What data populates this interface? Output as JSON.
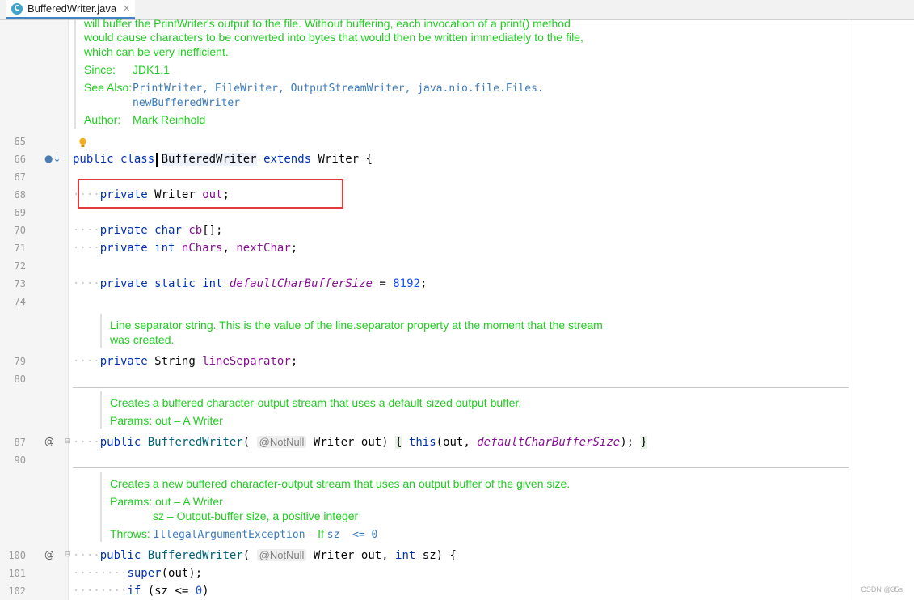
{
  "tab": {
    "icon": "C",
    "title": "BufferedWriter.java",
    "close": "✕"
  },
  "doc_top": {
    "line1": "will buffer the PrintWriter's output to the file. Without buffering, each invocation of a print() method",
    "line2": "would cause characters to be converted into bytes that would then be written immediately to the file,",
    "line3": "which can be very inefficient.",
    "since_label": "Since:",
    "since_value": "JDK1.1",
    "see_label": "See Also:",
    "see_value1": "PrintWriter, FileWriter, OutputStreamWriter, java.nio.file.Files.",
    "see_value2": "newBufferedWriter",
    "author_label": "Author:",
    "author_value": "Mark Reinhold"
  },
  "line_numbers": {
    "n65": "65",
    "n66": "66",
    "n67": "67",
    "n68": "68",
    "n69": "69",
    "n70": "70",
    "n71": "71",
    "n72": "72",
    "n73": "73",
    "n74": "74",
    "n79": "79",
    "n80": "80",
    "n87": "87",
    "n90": "90",
    "n100": "100",
    "n101": "101",
    "n102": "102"
  },
  "code": {
    "l66_kw1": "public",
    "l66_kw2": "class",
    "l66_name": "BufferedWriter",
    "l66_kw3": "extends",
    "l66_rest": "Writer {",
    "l68_kw": "private",
    "l68_type": "Writer",
    "l68_fld": "out",
    "l68_end": ";",
    "l70_kw": "private",
    "l70_type": "char",
    "l70_fld": "cb",
    "l70_end": "[];",
    "l71_kw": "private",
    "l71_type": "int",
    "l71_fld1": "nChars",
    "l71_sep": ", ",
    "l71_fld2": "nextChar",
    "l71_end": ";",
    "l73_kw1": "private",
    "l73_kw2": "static",
    "l73_type": "int",
    "l73_fld": "defaultCharBufferSize",
    "l73_eq": " = ",
    "l73_num": "8192",
    "l73_end": ";",
    "l79_kw": "private",
    "l79_type": "String",
    "l79_fld": "lineSeparator",
    "l79_end": ";",
    "l87_kw": "public",
    "l87_name": "BufferedWriter",
    "l87_open": "(",
    "l87_ann": "@NotNull",
    "l87_param": "Writer out)",
    "l87_body1": "{",
    "l87_this": "this",
    "l87_args1": "(out, ",
    "l87_arg2": "defaultCharBufferSize",
    "l87_args3": ");",
    "l87_close": "}",
    "l100_kw": "public",
    "l100_name": "BufferedWriter",
    "l100_open": "(",
    "l100_ann": "@NotNull",
    "l100_p1": "Writer out, ",
    "l100_int": "int",
    "l100_p2": " sz) {",
    "l101_kw": "super",
    "l101_rest": "(out);",
    "l102_kw": "if",
    "l102_rest": " (sz <= ",
    "l102_num": "0",
    "l102_end": ")"
  },
  "doc_lineSep": {
    "line1": "Line separator string. This is the value of the line.separator property at the moment that the stream",
    "line2": "was created."
  },
  "doc_ctor1": {
    "line1": "Creates a buffered character-output stream that uses a default-sized output buffer.",
    "params": "Params: out – A Writer"
  },
  "doc_ctor2": {
    "line1": "Creates a new buffered character-output stream that uses an output buffer of the given size.",
    "params1": "Params: out – A Writer",
    "params2": "sz – Output-buffer size, a positive integer",
    "throws_label": "Throws:",
    "throws_ex": "IllegalArgumentException",
    "throws_rest": " – If ",
    "throws_code": "sz  <= 0"
  },
  "gutter_icons": {
    "impl": "●↓",
    "at87": "@",
    "at100": "@"
  },
  "watermark": "CSDN @35s",
  "colors": {
    "keyword": "#0033b3",
    "field": "#871094",
    "doc": "#22cc22",
    "number": "#1750eb",
    "highlight_box": "#e23b3b"
  }
}
